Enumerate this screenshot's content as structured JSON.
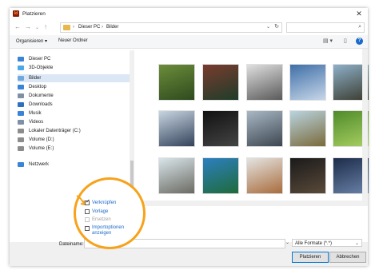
{
  "window": {
    "title": "Platzieren",
    "app_icon_text": "Id"
  },
  "address": {
    "crumbs": [
      "Dieser PC",
      "Bilder"
    ],
    "search_placeholder": ""
  },
  "toolbar": {
    "organize": "Organisieren",
    "new_folder": "Neuer Ordner"
  },
  "sidebar": {
    "items": [
      {
        "label": "Dieser PC",
        "icon": "computer-icon",
        "color": "#3a84d8"
      },
      {
        "label": "3D-Objekte",
        "icon": "cube-icon",
        "color": "#4aa8e8"
      },
      {
        "label": "Bilder",
        "icon": "pictures-folder-icon",
        "color": "#6fa8dc",
        "selected": true
      },
      {
        "label": "Desktop",
        "icon": "desktop-icon",
        "color": "#3a84d8"
      },
      {
        "label": "Dokumente",
        "icon": "documents-icon",
        "color": "#7f8fa6"
      },
      {
        "label": "Downloads",
        "icon": "downloads-icon",
        "color": "#2f6fbf"
      },
      {
        "label": "Musik",
        "icon": "music-icon",
        "color": "#3a84d8"
      },
      {
        "label": "Videos",
        "icon": "videos-icon",
        "color": "#7f8fa6"
      },
      {
        "label": "Lokaler Datenträger (C:)",
        "icon": "drive-icon",
        "color": "#8c8c8c"
      },
      {
        "label": "Volume (D:)",
        "icon": "drive-icon",
        "color": "#8c8c8c"
      },
      {
        "label": "Volume (E:)",
        "icon": "drive-icon",
        "color": "#8c8c8c"
      },
      {
        "label": "Netzwerk",
        "icon": "network-icon",
        "color": "#3a84d8"
      }
    ]
  },
  "thumbnails": [
    {
      "name": "photo-1",
      "colors": [
        "#6b8d3a",
        "#2e4a1e"
      ]
    },
    {
      "name": "photo-2",
      "colors": [
        "#7a3b2e",
        "#1e3d2a"
      ]
    },
    {
      "name": "photo-3",
      "colors": [
        "#e0e0e0",
        "#5a5a5a"
      ]
    },
    {
      "name": "photo-4",
      "colors": [
        "#3f6fa8",
        "#c7d6e8"
      ]
    },
    {
      "name": "photo-5",
      "colors": [
        "#8db0c9",
        "#3b3b2e"
      ]
    },
    {
      "name": "photo-6",
      "colors": [
        "#c8d6e2",
        "#33425a"
      ]
    },
    {
      "name": "photo-7",
      "colors": [
        "#111111",
        "#444444"
      ]
    },
    {
      "name": "photo-8",
      "colors": [
        "#a9b8c6",
        "#3c4650"
      ]
    },
    {
      "name": "photo-9",
      "colors": [
        "#b9d4e0",
        "#7a6a3a"
      ]
    },
    {
      "name": "photo-10",
      "colors": [
        "#4f8b2a",
        "#a8cf62"
      ]
    },
    {
      "name": "photo-11",
      "colors": [
        "#d9e5ea",
        "#6a6a62"
      ]
    },
    {
      "name": "photo-12",
      "colors": [
        "#2d7fc0",
        "#1e6b3a"
      ]
    },
    {
      "name": "photo-13",
      "colors": [
        "#e4e4e2",
        "#a86c3c"
      ]
    },
    {
      "name": "photo-14",
      "colors": [
        "#1a1a1a",
        "#5a4a3a"
      ]
    },
    {
      "name": "photo-15",
      "colors": [
        "#1c2c4a",
        "#6a82a8"
      ]
    }
  ],
  "options": {
    "link": {
      "label": "Verknüpfen",
      "checked": true
    },
    "template": {
      "label": "Vorlage",
      "checked": false
    },
    "replace": {
      "label": "Ersetzen",
      "checked": false,
      "disabled": true
    },
    "import_options": {
      "label_line1": "Importoptionen",
      "label_line2": "anzeigen",
      "checked": false
    }
  },
  "bottom": {
    "filename_label": "Dateiname:",
    "filename_value": "",
    "filter": "Alle Formate (*.*)",
    "place_button": "Platzieren",
    "cancel_button": "Abbrechen"
  },
  "colors": {
    "accent": "#f7a21b",
    "link": "#1c6ac9",
    "selection": "#dbe7f5"
  }
}
